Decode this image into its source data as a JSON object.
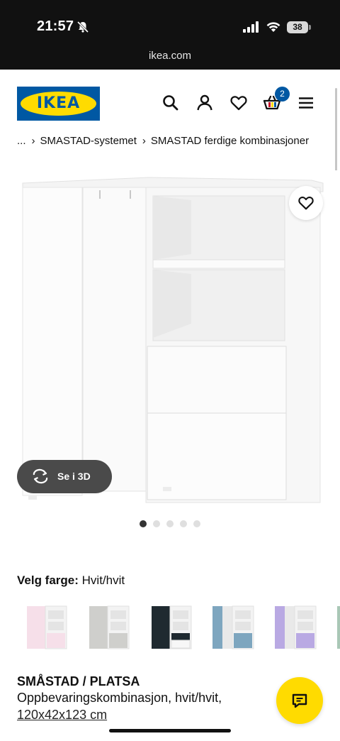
{
  "status_bar": {
    "time": "21:57",
    "battery": "38",
    "url": "ikea.com"
  },
  "header": {
    "logo_text": "IKEA",
    "cart_count": "2",
    "icons": [
      "search-icon",
      "profile-icon",
      "heart-icon",
      "cart-icon",
      "menu-icon"
    ],
    "brand_blue": "#0058a3",
    "brand_yellow": "#ffdb00"
  },
  "breadcrumb": {
    "ellipsis": "...",
    "items": [
      "SMASTAD-systemet",
      "SMASTAD ferdige kombinasjoner"
    ]
  },
  "gallery": {
    "view_3d_label": "Se i 3D",
    "image_count": 5,
    "active_index": 0
  },
  "color_picker": {
    "label": "Velg farge:",
    "selected": "Hvit/hvit",
    "swatches": [
      "pink-white",
      "grey-white",
      "black-white",
      "blue-white",
      "lilac-white",
      "green-white"
    ]
  },
  "product": {
    "name": "SMÅSTAD / PLATSA",
    "description": "Oppbevaringskombinasjon, hvit/hvit,",
    "size": "120x42x123 cm"
  }
}
